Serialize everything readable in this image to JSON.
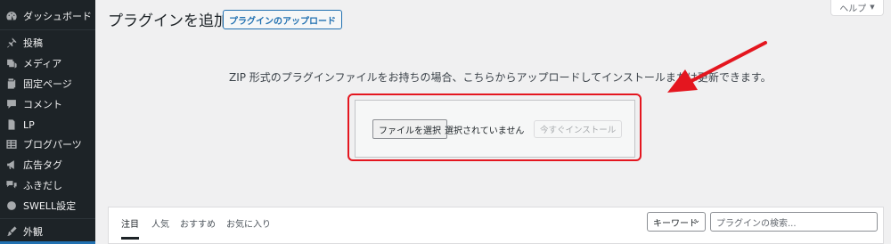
{
  "sidebar": {
    "items": [
      {
        "label": "ダッシュボード",
        "icon": "dashboard-icon"
      },
      {
        "label": "投稿",
        "icon": "pin-icon"
      },
      {
        "label": "メディア",
        "icon": "media-icon"
      },
      {
        "label": "固定ページ",
        "icon": "page-icon"
      },
      {
        "label": "コメント",
        "icon": "comment-icon"
      },
      {
        "label": "LP",
        "icon": "document-icon"
      },
      {
        "label": "ブログパーツ",
        "icon": "table-icon"
      },
      {
        "label": "広告タグ",
        "icon": "megaphone-icon"
      },
      {
        "label": "ふきだし",
        "icon": "speech-bubble-icon"
      },
      {
        "label": "SWELL設定",
        "icon": "swell-icon"
      },
      {
        "label": "外観",
        "icon": "brush-icon"
      }
    ]
  },
  "header": {
    "title": "プラグインを追加",
    "upload_button": "プラグインのアップロード",
    "help": "ヘルプ"
  },
  "upload": {
    "description": "ZIP 形式のプラグインファイルをお持ちの場合、こちらからアップロードしてインストールまたは更新できます。",
    "file_button": "ファイルを選択",
    "file_status": "選択されていません",
    "install_button": "今すぐインストール"
  },
  "filter": {
    "tabs": [
      "注目",
      "人気",
      "おすすめ",
      "お気に入り"
    ],
    "search_type": "キーワード",
    "search_placeholder": "プラグインの検索..."
  },
  "colors": {
    "sidebar_bg": "#1d2327",
    "accent": "#2271b1",
    "highlight": "#e4161f"
  }
}
